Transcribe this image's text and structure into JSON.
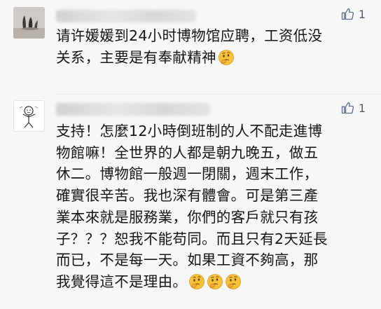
{
  "comments": [
    {
      "likes": "1",
      "text": "请许媛媛到24小时博物馆应聘，工资低没\n关系，主要是有奉献精神",
      "emojis": [
        "thinking-face-emoji"
      ]
    },
    {
      "likes": "1",
      "text": "支持！怎麼12小時倒班制的人不配走進博\n物館嘛！全世界的人都是朝九晚五，做五\n休二。博物館一般週一閉關，週末工作，\n確實很辛苦。我也深有體會。可是第三產\n業本來就是服務業，你們的客戶就只有孩\n子？？？恕我不能苟同。而且只有2天延長\n而已，不是每一天。如果工資不夠高，那\n我覺得這不是理由。",
      "emojis": [
        "thinking-face-emoji",
        "thinking-face-emoji",
        "thinking-face-emoji"
      ]
    }
  ],
  "icons": {
    "like": "thumbs-up-icon",
    "emoji": "thinking-face-emoji"
  },
  "colors": {
    "like_icon": "#5a6e93",
    "emoji_fill": "#f6c23a"
  }
}
